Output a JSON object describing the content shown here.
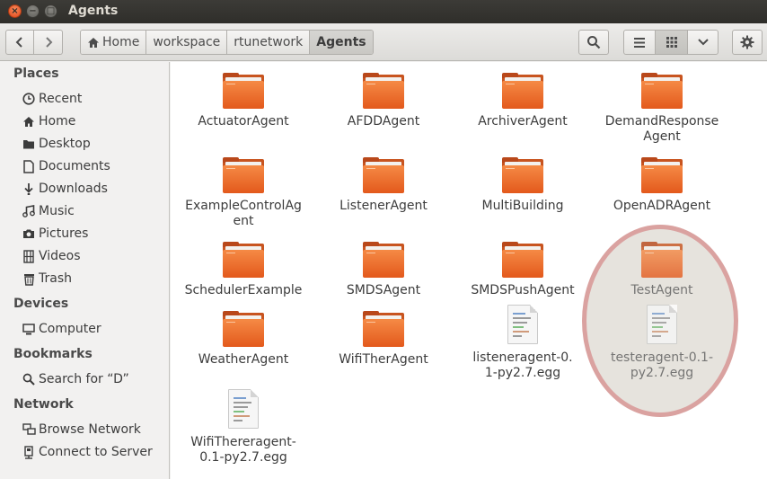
{
  "window": {
    "title": "Agents",
    "close_glyph": "×",
    "min_glyph": "−",
    "max_glyph": "□"
  },
  "toolbar": {
    "back_icon": "‹",
    "forward_icon": "›",
    "breadcrumbs": [
      "Home",
      "workspace",
      "rtunetwork",
      "Agents"
    ],
    "search_icon": "search-icon",
    "list_view_icon": "list-icon",
    "grid_view_icon": "grid-icon",
    "menu_icon": "chevron-down-icon",
    "settings_icon": "gear-icon"
  },
  "sidebar": {
    "places_title": "Places",
    "places": [
      {
        "label": "Recent",
        "icon": "clock-icon"
      },
      {
        "label": "Home",
        "icon": "home-icon"
      },
      {
        "label": "Desktop",
        "icon": "desktop-icon"
      },
      {
        "label": "Documents",
        "icon": "document-icon"
      },
      {
        "label": "Downloads",
        "icon": "download-icon"
      },
      {
        "label": "Music",
        "icon": "music-icon"
      },
      {
        "label": "Pictures",
        "icon": "camera-icon"
      },
      {
        "label": "Videos",
        "icon": "film-icon"
      },
      {
        "label": "Trash",
        "icon": "trash-icon"
      }
    ],
    "devices_title": "Devices",
    "devices": [
      {
        "label": "Computer",
        "icon": "computer-icon"
      }
    ],
    "bookmarks_title": "Bookmarks",
    "bookmarks": [
      {
        "label": "Search for “D”",
        "icon": "search-icon"
      }
    ],
    "network_title": "Network",
    "network": [
      {
        "label": "Browse Network",
        "icon": "network-icon"
      },
      {
        "label": "Connect to Server",
        "icon": "server-icon"
      }
    ]
  },
  "files": [
    {
      "name": "ActuatorAgent",
      "type": "folder"
    },
    {
      "name": "AFDDAgent",
      "type": "folder"
    },
    {
      "name": "ArchiverAgent",
      "type": "folder"
    },
    {
      "name": "DemandResponseAgent",
      "type": "folder"
    },
    {
      "name": "ExampleControlAgent",
      "type": "folder"
    },
    {
      "name": "ListenerAgent",
      "type": "folder"
    },
    {
      "name": "MultiBuilding",
      "type": "folder"
    },
    {
      "name": "OpenADRAgent",
      "type": "folder"
    },
    {
      "name": "SchedulerExample",
      "type": "folder"
    },
    {
      "name": "SMDSAgent",
      "type": "folder"
    },
    {
      "name": "SMDSPushAgent",
      "type": "folder"
    },
    {
      "name": "TestAgent",
      "type": "folder"
    },
    {
      "name": "WeatherAgent",
      "type": "folder"
    },
    {
      "name": "WifiTherAgent",
      "type": "folder"
    },
    {
      "name": "listeneragent-0.1-py2.7.egg",
      "type": "file"
    },
    {
      "name": "testeragent-0.1-py2.7.egg",
      "type": "file"
    },
    {
      "name": "WifiThereragent-0.1-py2.7.egg",
      "type": "file"
    }
  ],
  "colors": {
    "folder_orange": "#f0742e",
    "highlight_ring": "#d68c8c",
    "titlebar": "#3c3b37"
  }
}
